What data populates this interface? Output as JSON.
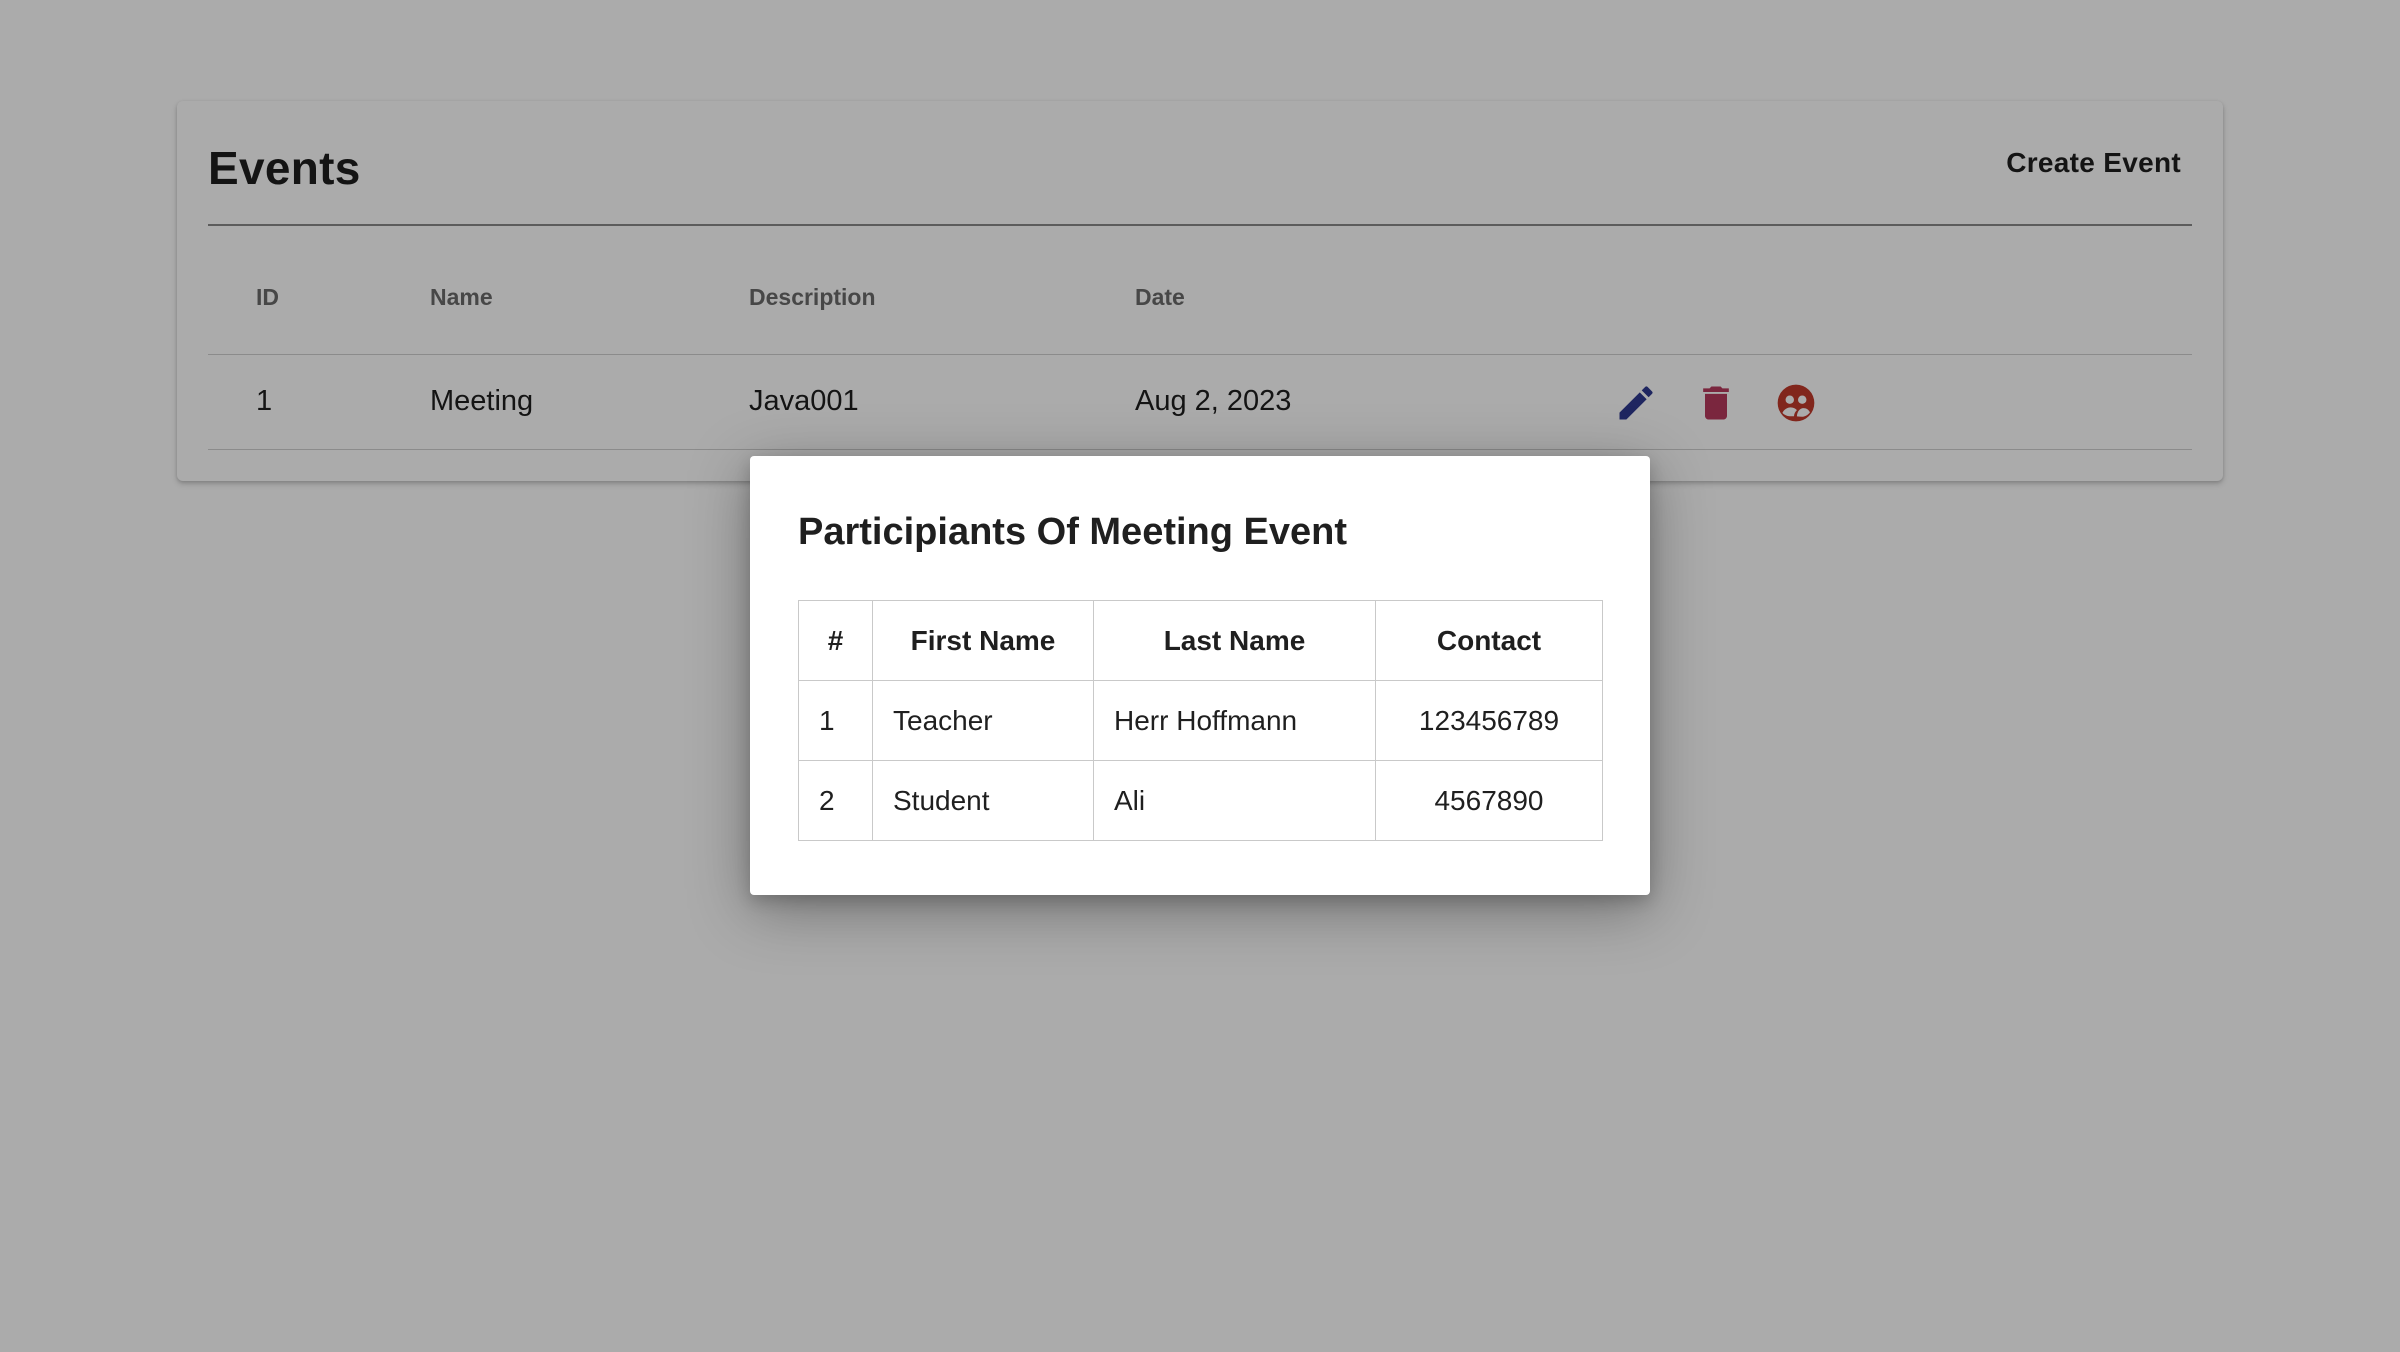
{
  "events_page": {
    "title": "Events",
    "create_button": "Create Event",
    "columns": [
      "ID",
      "Name",
      "Description",
      "Date"
    ],
    "rows": [
      {
        "id": "1",
        "name": "Meeting",
        "description": "Java001",
        "date": "Aug 2, 2023"
      }
    ],
    "actions": {
      "edit_icon": "pencil-icon",
      "delete_icon": "trash-icon",
      "participants_icon": "participants-icon",
      "edit_color": "#2f3a8f",
      "delete_color": "#b63a5d",
      "participants_color": "#c0392b"
    }
  },
  "modal": {
    "title": "Participiants Of Meeting Event",
    "columns": [
      "#",
      "First Name",
      "Last Name",
      "Contact"
    ],
    "rows": [
      {
        "num": "1",
        "first": "Teacher",
        "last": "Herr Hoffmann",
        "contact": "123456789"
      },
      {
        "num": "2",
        "first": "Student",
        "last": "Ali",
        "contact": "4567890"
      }
    ]
  },
  "colors": {
    "overlay": "rgba(0,0,0,0.33)",
    "card_bg": "#ffffff",
    "text": "#1f1f1f",
    "header_text": "#6b6b6b"
  }
}
